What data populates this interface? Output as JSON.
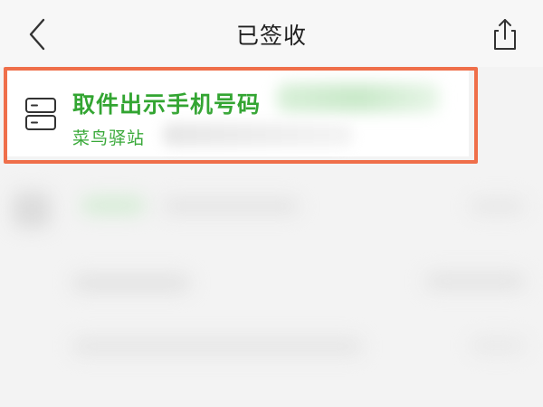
{
  "header": {
    "title": "已签收",
    "back_icon": "chevron-left-icon",
    "share_icon": "share-icon"
  },
  "pickup_card": {
    "icon": "database-icon",
    "pickup_label": "取件出示手机号码",
    "station_label": "菜鸟驿站",
    "highlight_color": "#ef6f4a",
    "accent_color": "#33a532"
  }
}
